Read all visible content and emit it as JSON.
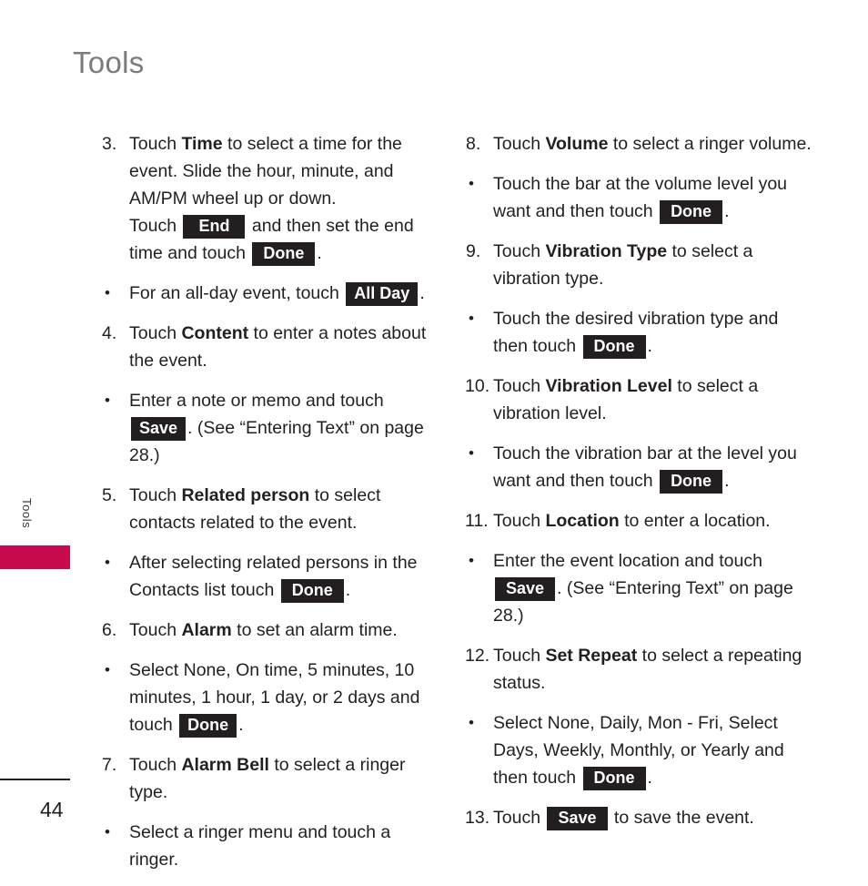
{
  "document": {
    "title": "Tools",
    "page_number": "44",
    "side_tab_label": "Tools",
    "accent_color": "#c80b4e",
    "title_color": "#7b7b7b",
    "key_badge_color": "#231f20"
  },
  "columns": {
    "left": [
      {
        "marker": "3.",
        "type": "numbered",
        "segments": [
          {
            "kind": "text",
            "value": "Touch "
          },
          {
            "kind": "bold",
            "value": "Time"
          },
          {
            "kind": "text",
            "value": " to select a time for the event. Slide the hour, minute, and AM/PM wheel up or down."
          },
          {
            "kind": "break"
          },
          {
            "kind": "text",
            "value": "Touch "
          },
          {
            "kind": "key",
            "value": "End",
            "pad": "wide"
          },
          {
            "kind": "text",
            "value": " and then set the end time and touch "
          },
          {
            "kind": "key",
            "value": "Done",
            "pad": "mid"
          },
          {
            "kind": "text",
            "value": "."
          }
        ]
      },
      {
        "marker": "•",
        "type": "bullet",
        "segments": [
          {
            "kind": "text",
            "value": "For an all-day event, touch "
          },
          {
            "kind": "key",
            "value": "All Day",
            "pad": "normal"
          },
          {
            "kind": "text",
            "value": "."
          }
        ]
      },
      {
        "marker": "4.",
        "type": "numbered",
        "segments": [
          {
            "kind": "text",
            "value": "Touch "
          },
          {
            "kind": "bold",
            "value": "Content"
          },
          {
            "kind": "text",
            "value": " to enter a notes about the event."
          }
        ]
      },
      {
        "marker": "•",
        "type": "bullet",
        "segments": [
          {
            "kind": "text",
            "value": "Enter a note or memo and touch "
          },
          {
            "kind": "key",
            "value": "Save",
            "pad": "normal"
          },
          {
            "kind": "text",
            "value": ". (See “Entering Text” on page 28.)"
          }
        ]
      },
      {
        "marker": "5.",
        "type": "numbered",
        "segments": [
          {
            "kind": "text",
            "value": "Touch "
          },
          {
            "kind": "bold",
            "value": "Related person"
          },
          {
            "kind": "text",
            "value": " to select contacts related to the event."
          }
        ]
      },
      {
        "marker": "•",
        "type": "bullet",
        "segments": [
          {
            "kind": "text",
            "value": "After selecting related persons in the Contacts list touch "
          },
          {
            "kind": "key",
            "value": "Done",
            "pad": "mid"
          },
          {
            "kind": "text",
            "value": "."
          }
        ]
      },
      {
        "marker": "6.",
        "type": "numbered",
        "segments": [
          {
            "kind": "text",
            "value": "Touch "
          },
          {
            "kind": "bold",
            "value": "Alarm"
          },
          {
            "kind": "text",
            "value": " to set an alarm time."
          }
        ]
      },
      {
        "marker": "•",
        "type": "bullet",
        "segments": [
          {
            "kind": "text",
            "value": "Select None, On time, 5 minutes, 10 minutes, 1 hour, 1 day, or 2 days and touch "
          },
          {
            "kind": "key",
            "value": "Done",
            "pad": "normal"
          },
          {
            "kind": "text",
            "value": "."
          }
        ]
      },
      {
        "marker": "7.",
        "type": "numbered",
        "segments": [
          {
            "kind": "text",
            "value": "Touch "
          },
          {
            "kind": "bold",
            "value": "Alarm Bell"
          },
          {
            "kind": "text",
            "value": " to select a ringer type."
          }
        ]
      },
      {
        "marker": "•",
        "type": "bullet",
        "segments": [
          {
            "kind": "text",
            "value": "Select a ringer menu and touch a ringer."
          }
        ]
      }
    ],
    "right": [
      {
        "marker": "8.",
        "type": "numbered",
        "segments": [
          {
            "kind": "text",
            "value": "Touch "
          },
          {
            "kind": "bold",
            "value": "Volume"
          },
          {
            "kind": "text",
            "value": " to select a ringer volume."
          }
        ]
      },
      {
        "marker": "•",
        "type": "bullet",
        "segments": [
          {
            "kind": "text",
            "value": "Touch the bar at the volume level you want and then touch "
          },
          {
            "kind": "key",
            "value": "Done",
            "pad": "mid"
          },
          {
            "kind": "text",
            "value": "."
          }
        ]
      },
      {
        "marker": "9.",
        "type": "numbered",
        "segments": [
          {
            "kind": "text",
            "value": "Touch "
          },
          {
            "kind": "bold",
            "value": "Vibration Type"
          },
          {
            "kind": "text",
            "value": " to select a vibration type."
          }
        ]
      },
      {
        "marker": "•",
        "type": "bullet",
        "segments": [
          {
            "kind": "text",
            "value": "Touch the desired vibration type and then touch "
          },
          {
            "kind": "key",
            "value": "Done",
            "pad": "mid"
          },
          {
            "kind": "text",
            "value": "."
          }
        ]
      },
      {
        "marker": "10.",
        "type": "numbered-wide",
        "segments": [
          {
            "kind": "text",
            "value": "Touch "
          },
          {
            "kind": "bold",
            "value": "Vibration Level"
          },
          {
            "kind": "text",
            "value": " to select a vibration level."
          }
        ]
      },
      {
        "marker": "•",
        "type": "bullet",
        "segments": [
          {
            "kind": "text",
            "value": "Touch the vibration bar at the level you want and then touch "
          },
          {
            "kind": "key",
            "value": "Done",
            "pad": "mid"
          },
          {
            "kind": "text",
            "value": "."
          }
        ]
      },
      {
        "marker": "11.",
        "type": "numbered-wide",
        "segments": [
          {
            "kind": "text",
            "value": "Touch "
          },
          {
            "kind": "bold",
            "value": "Location"
          },
          {
            "kind": "text",
            "value": " to enter a location."
          }
        ]
      },
      {
        "marker": "•",
        "type": "bullet",
        "segments": [
          {
            "kind": "text",
            "value": "Enter the event location and touch "
          },
          {
            "kind": "key",
            "value": "Save",
            "pad": "mid"
          },
          {
            "kind": "text",
            "value": ". (See “Entering Text” on page 28.)"
          }
        ]
      },
      {
        "marker": "12.",
        "type": "numbered-wide",
        "segments": [
          {
            "kind": "text",
            "value": "Touch "
          },
          {
            "kind": "bold",
            "value": "Set Repeat"
          },
          {
            "kind": "text",
            "value": " to select a repeating status."
          }
        ]
      },
      {
        "marker": "•",
        "type": "bullet",
        "segments": [
          {
            "kind": "text",
            "value": "Select None, Daily, Mon - Fri, Select Days, Weekly, Monthly, or Yearly and then touch "
          },
          {
            "kind": "key",
            "value": "Done",
            "pad": "mid"
          },
          {
            "kind": "text",
            "value": "."
          }
        ]
      },
      {
        "marker": "13.",
        "type": "numbered-wide",
        "segments": [
          {
            "kind": "text",
            "value": "Touch "
          },
          {
            "kind": "key",
            "value": "Save",
            "pad": "mid"
          },
          {
            "kind": "text",
            "value": " to save the event."
          }
        ]
      }
    ]
  }
}
